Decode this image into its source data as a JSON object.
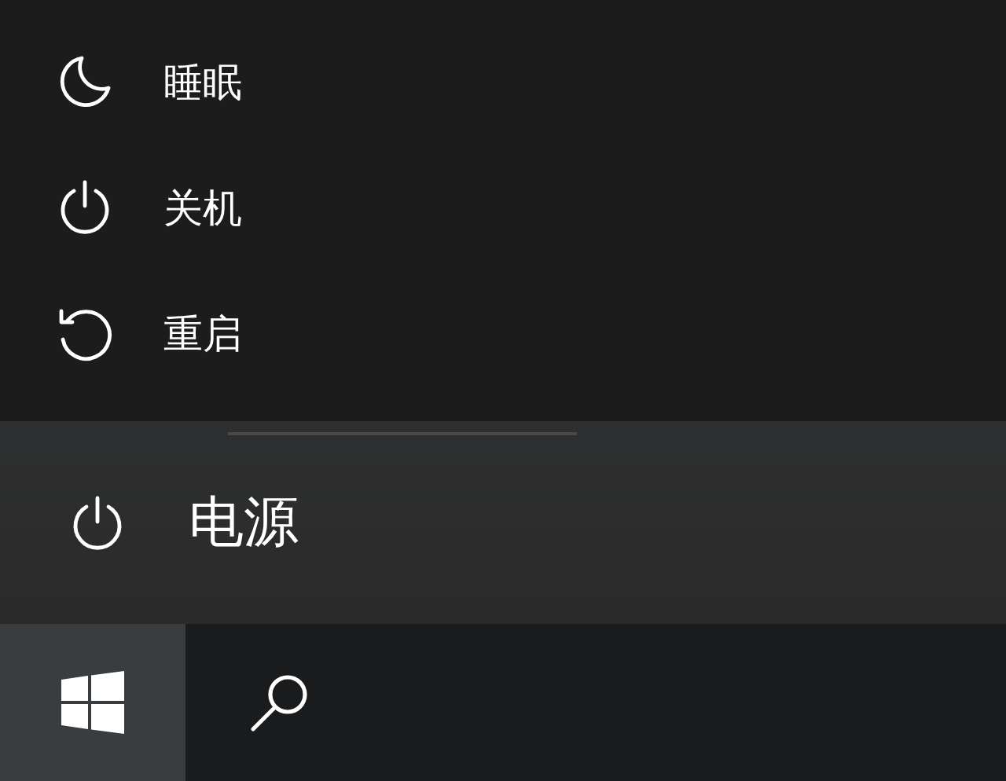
{
  "power_menu": {
    "items": [
      {
        "kind": "sleep",
        "label": "睡眠"
      },
      {
        "kind": "shutdown",
        "label": "关机"
      },
      {
        "kind": "restart",
        "label": "重启"
      }
    ]
  },
  "power_button": {
    "label": "电源"
  },
  "taskbar": {
    "buttons": [
      {
        "kind": "start",
        "selected": true
      },
      {
        "kind": "search",
        "selected": false
      }
    ]
  }
}
